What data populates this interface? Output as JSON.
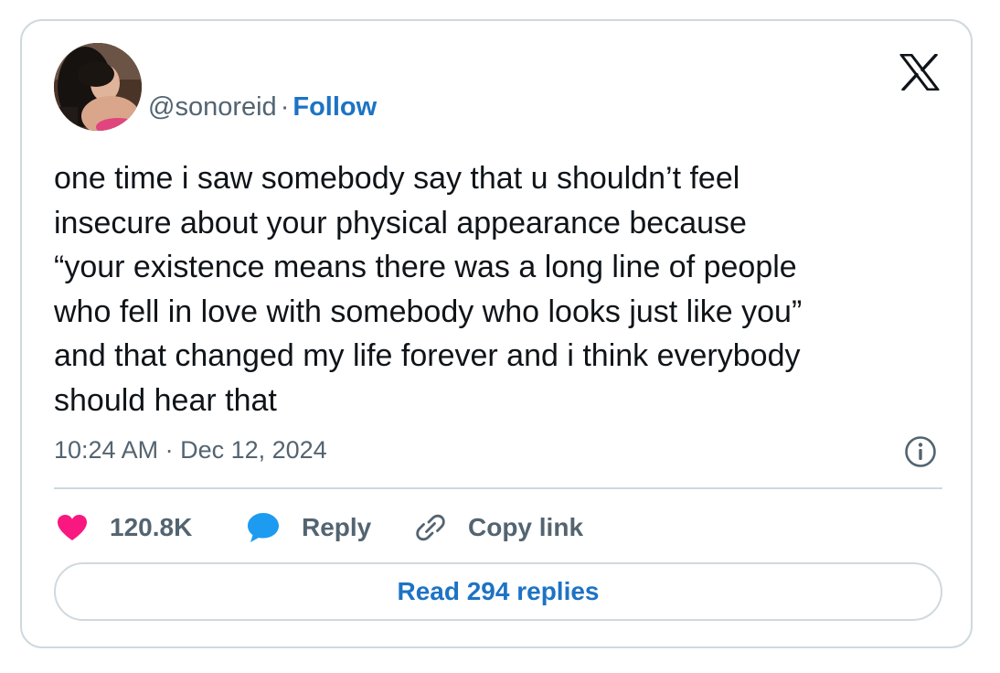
{
  "tweet": {
    "handle": "@sonoreid",
    "separator": "·",
    "follow_label": "Follow",
    "text": "one time i saw somebody say that u shouldn’t feel\ninsecure about your physical appearance because\n“your existence means there was a long line of people\nwho fell in love with somebody who looks just like you”\nand that changed my life forever and i think everybody\nshould hear that",
    "timestamp": "10:24 AM · Dec 12, 2024"
  },
  "actions": {
    "like_count": "120.8K",
    "reply_label": "Reply",
    "copy_link_label": "Copy link"
  },
  "read_replies_label": "Read 294 replies",
  "colors": {
    "accent": "#1d73c4",
    "like": "#f91880",
    "reply_icon": "#1d9bf0",
    "border": "#cfd9de",
    "secondary_text": "#536471"
  },
  "icons": {
    "brand": "x-logo-icon",
    "info": "info-icon",
    "like": "heart-icon",
    "reply": "speech-bubble-icon",
    "copy": "link-icon"
  }
}
